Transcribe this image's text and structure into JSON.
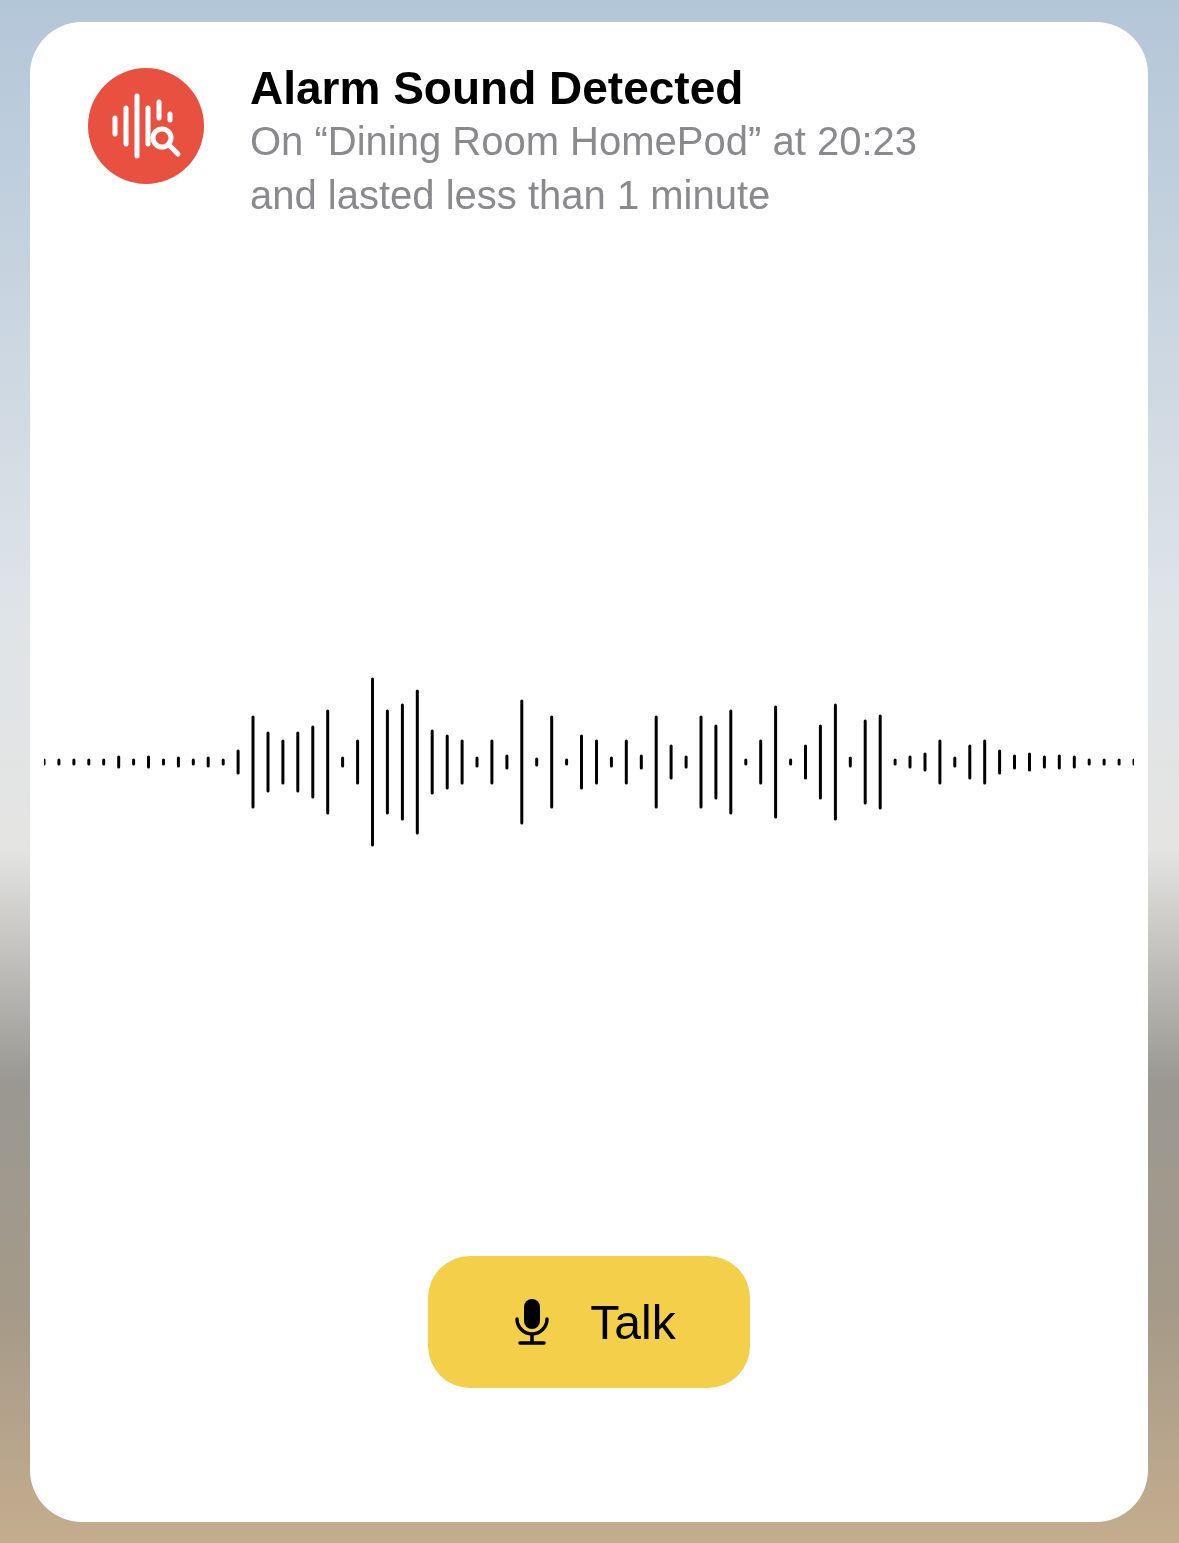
{
  "notification": {
    "title": "Alarm Sound Detected",
    "lines": [
      "On “Dining Room HomePod” at 20:23",
      "and lasted less than 1 minute"
    ]
  },
  "talk_button": {
    "label": "Talk"
  }
}
